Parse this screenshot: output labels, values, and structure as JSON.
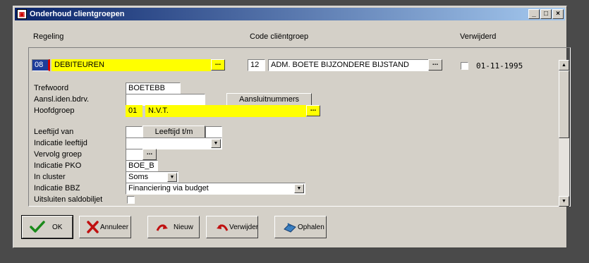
{
  "window": {
    "title": "Onderhoud clientgroepen",
    "minimize": "_",
    "maximize": "□",
    "close": "×"
  },
  "headers": {
    "regeling": "Regeling",
    "code": "Code cliëntgroep",
    "verwijderd": "Verwijderd"
  },
  "row": {
    "regeling_code": "08",
    "regeling_name": "DEBITEUREN",
    "client_code": "12",
    "client_name": "ADM. BOETE BIJZONDERE BIJSTAND",
    "verwijderd_checked": false,
    "verwijderd_date": "01-11-1995"
  },
  "lookup_label": "...",
  "form": {
    "trefwoord_label": "Trefwoord",
    "trefwoord_value": "BOETEBB",
    "aansl_label": "Aansl.iden.bdrv.",
    "aansl_value": "",
    "aansluitnummers_button": "Aansluitnummers",
    "hoofdgroep_label": "Hoofdgroep",
    "hoofdgroep_code": "01",
    "hoofdgroep_name": "N.V.T.",
    "leeftijd_van_label": "Leeftijd van",
    "leeftijd_van_value": "",
    "leeftijd_tm_button": "Leeftijd t/m",
    "leeftijd_tm_value": "",
    "indicatie_leeftijd_label": "Indicatie leeftijd",
    "indicatie_leeftijd_value": "",
    "vervolg_groep_label": "Vervolg groep",
    "vervolg_groep_value": "",
    "indicatie_pko_label": "Indicatie PKO",
    "indicatie_pko_value": "BOE_B",
    "in_cluster_label": "In cluster",
    "in_cluster_value": "Soms",
    "indicatie_bbz_label": "Indicatie BBZ",
    "indicatie_bbz_value": "Financiering via budget",
    "uitsluiten_label": "Uitsluiten saldobiljet",
    "uitsluiten_checked": false
  },
  "buttons": {
    "ok": "OK",
    "annuleer": "Annuleer",
    "nieuw": "Nieuw",
    "verwijder": "Verwijder",
    "ophalen": "Ophalen"
  },
  "icons": {
    "ok": "checkmark-icon",
    "annuleer": "x-icon",
    "nieuw": "curved-arrow-icon",
    "verwijder": "curved-arrow-back-icon",
    "ophalen": "fetch-icon"
  },
  "colors": {
    "highlight": "#ffff00",
    "title_start": "#0a246a",
    "title_end": "#a6caf0"
  }
}
